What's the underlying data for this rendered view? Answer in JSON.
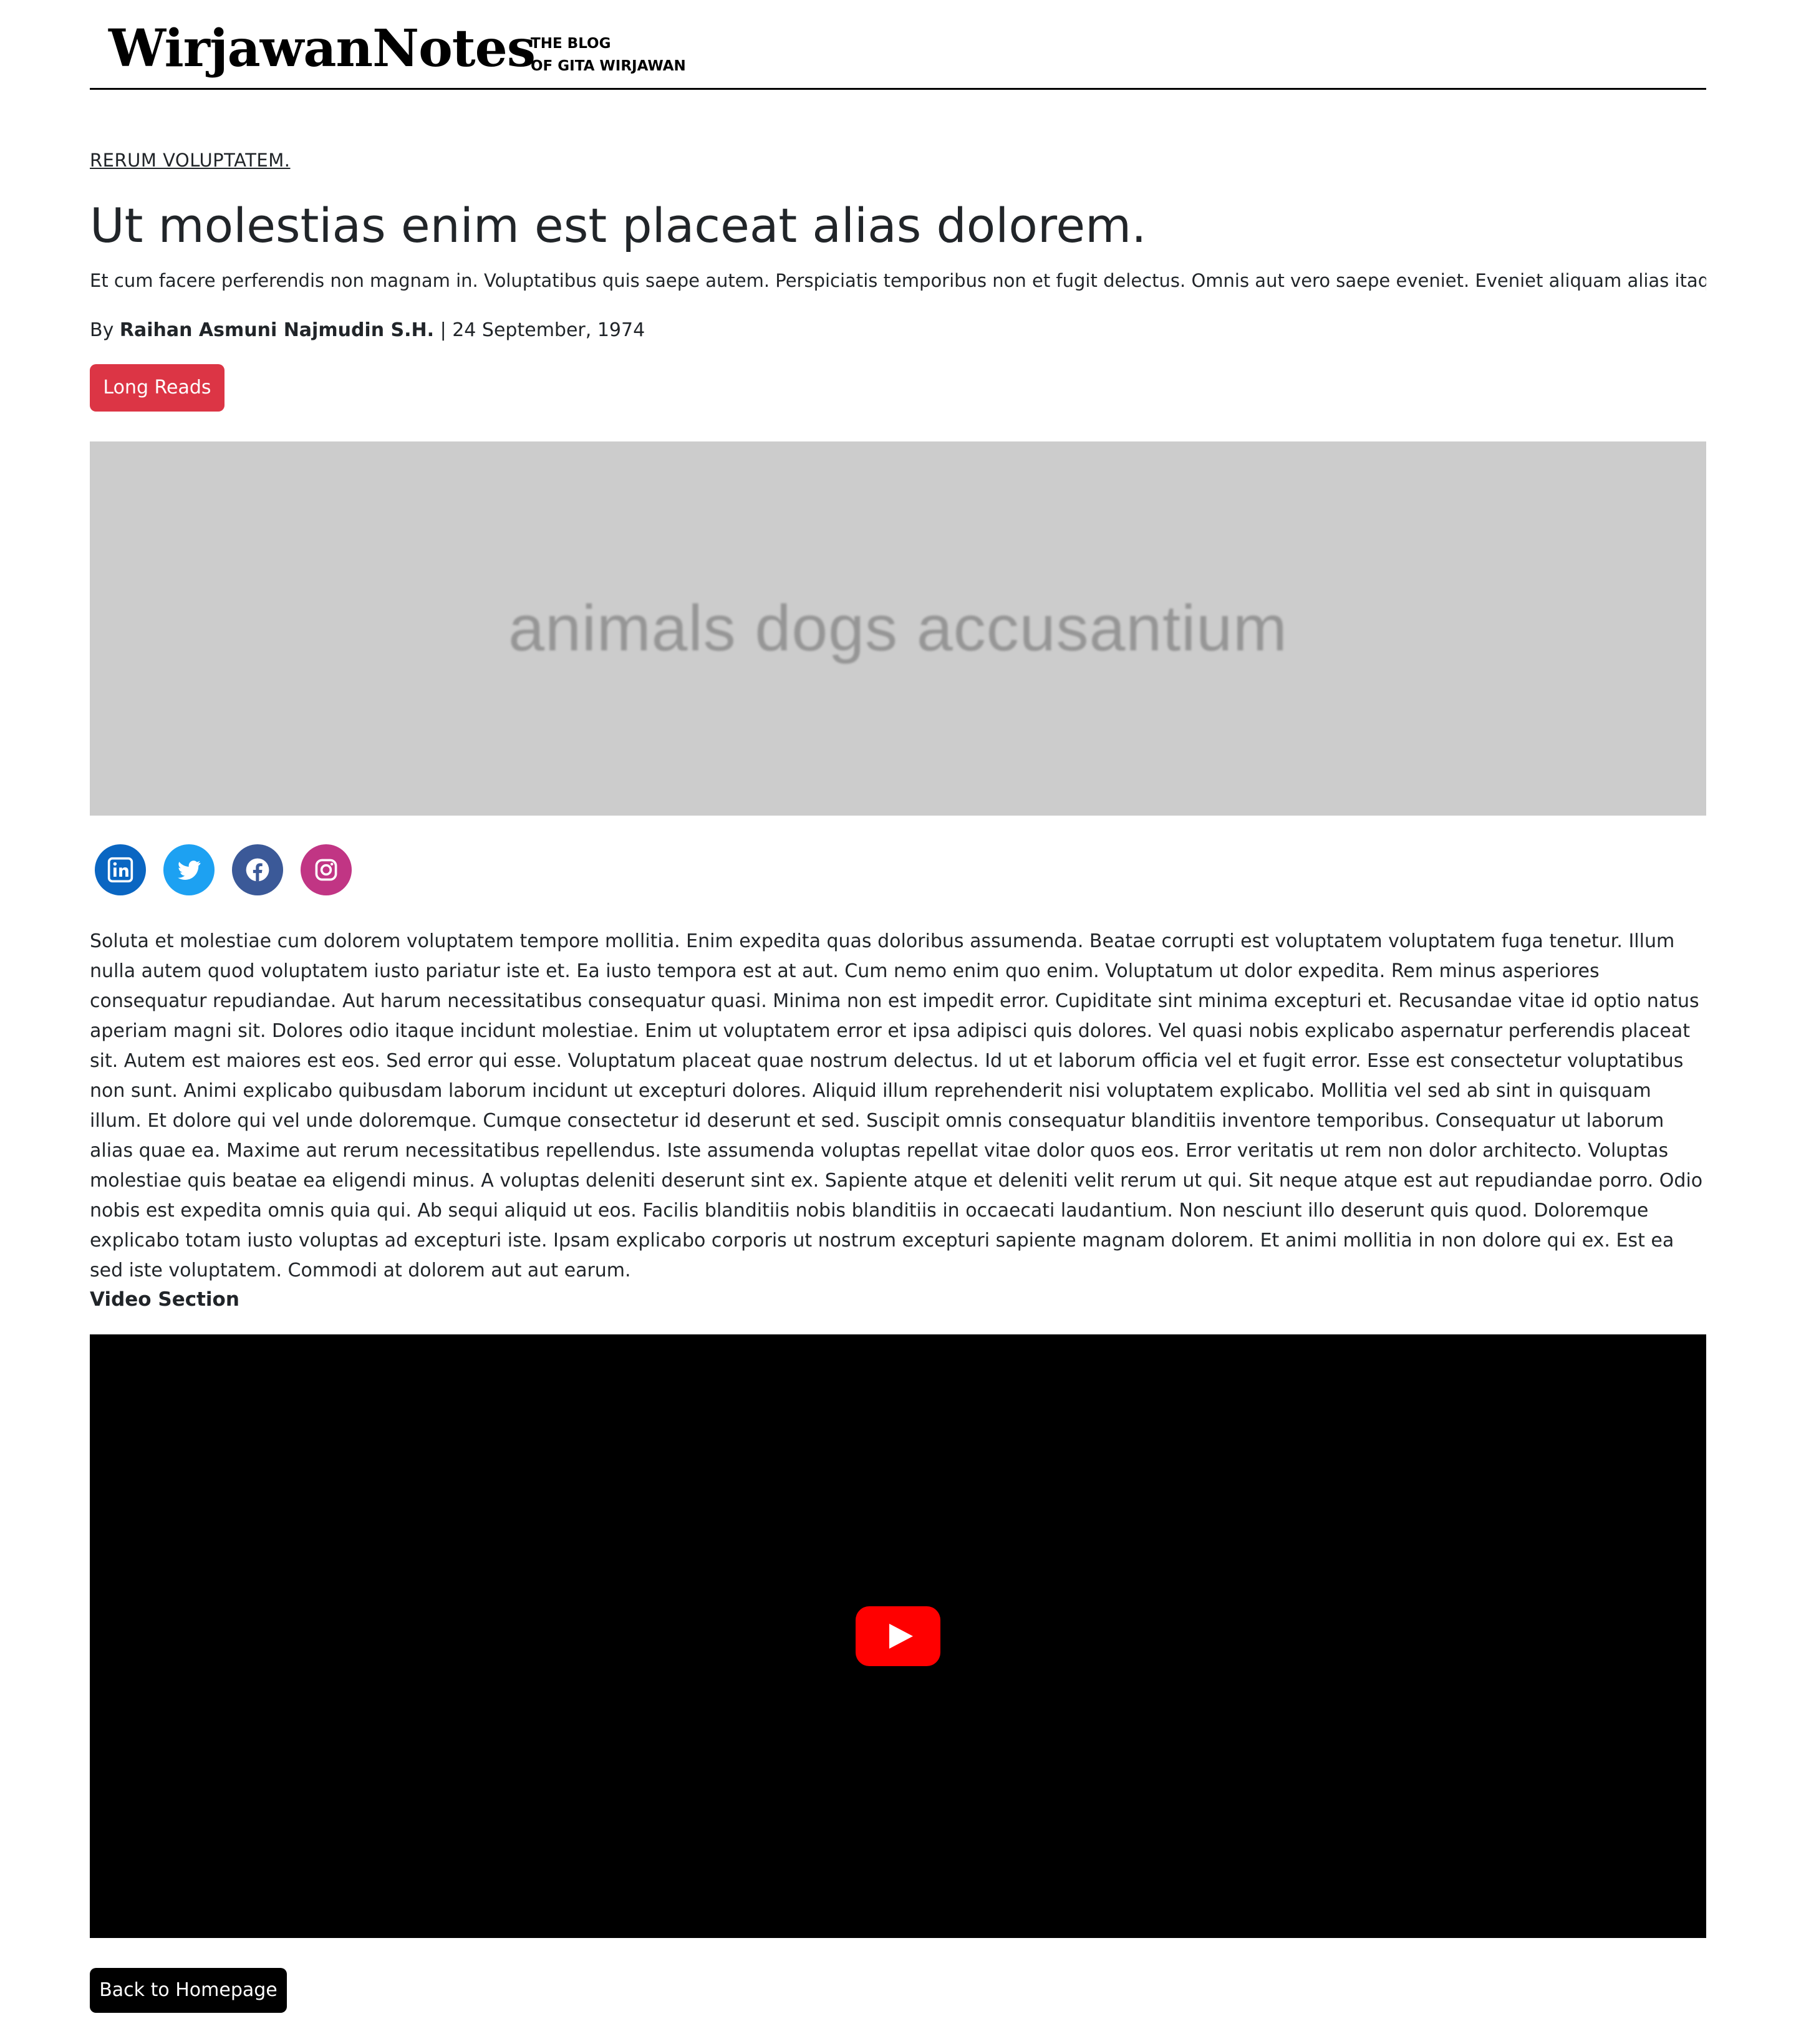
{
  "header": {
    "logo": "WirjawanNotes",
    "tagline_line1": "THE BLOG",
    "tagline_line2": "OF GITA WIRJAWAN"
  },
  "article": {
    "category": "RERUM VOLUPTATEM.",
    "title": "Ut molestias enim est placeat alias dolorem.",
    "subtitle": "Et cum facere perferendis non magnam in. Voluptatibus quis saepe autem. Perspiciatis temporibus non et fugit delectus. Omnis aut vero saepe eveniet. Eveniet aliquam alias itaque sed.",
    "byline_prefix": "By",
    "author": "Raihan Asmuni Najmudin S.H.",
    "date_separator": "| 24 September, 1974",
    "tag_label": "Long Reads",
    "hero_image_text": "animals dogs accusantium",
    "body": "Soluta et molestiae cum dolorem voluptatem tempore mollitia. Enim expedita quas doloribus assumenda. Beatae corrupti est voluptatem voluptatem fuga tenetur. Illum nulla autem quod voluptatem iusto pariatur iste et. Ea iusto tempora est at aut. Cum nemo enim quo enim. Voluptatum ut dolor expedita. Rem minus asperiores consequatur repudiandae. Aut harum necessitatibus consequatur quasi. Minima non est impedit error. Cupiditate sint minima excepturi et. Recusandae vitae id optio natus aperiam magni sit. Dolores odio itaque incidunt molestiae. Enim ut voluptatem error et ipsa adipisci quis dolores. Vel quasi nobis explicabo aspernatur perferendis placeat sit. Autem est maiores est eos. Sed error qui esse. Voluptatum placeat quae nostrum delectus. Id ut et laborum officia vel et fugit error. Esse est consectetur voluptatibus non sunt. Animi explicabo quibusdam laborum incidunt ut excepturi dolores. Aliquid illum reprehenderit nisi voluptatem explicabo. Mollitia vel sed ab sint in quisquam illum. Et dolore qui vel unde doloremque. Cumque consectetur id deserunt et sed. Suscipit omnis consequatur blanditiis inventore temporibus. Consequatur ut laborum alias quae ea. Maxime aut rerum necessitatibus repellendus. Iste assumenda voluptas repellat vitae dolor quos eos. Error veritatis ut rem non dolor architecto. Voluptas molestiae quis beatae ea eligendi minus. A voluptas deleniti deserunt sint ex. Sapiente atque et deleniti velit rerum ut qui. Sit neque atque est aut repudiandae porro. Odio nobis est expedita omnis quia qui. Ab sequi aliquid ut eos. Facilis blanditiis nobis blanditiis in occaecati laudantium. Non nesciunt illo deserunt quis quod. Doloremque explicabo totam iusto voluptas ad excepturi iste. Ipsam explicabo corporis ut nostrum excepturi sapiente magnam dolorem. Et animi mollitia in non dolore qui ex. Est ea sed iste voluptatem. Commodi at dolorem aut aut earum.",
    "video_heading": "Video Section",
    "back_label": "Back to Homepage"
  },
  "socials": [
    {
      "icon": "linkedin-icon",
      "color": "#0a66c2"
    },
    {
      "icon": "twitter-icon",
      "color": "#1da1f2"
    },
    {
      "icon": "facebook-icon",
      "color": "#3b5998"
    },
    {
      "icon": "instagram-icon",
      "color": "#c13584"
    }
  ],
  "colors": {
    "tag_red": "#dc3545",
    "youtube_red": "#ff0000",
    "text": "#212529"
  }
}
